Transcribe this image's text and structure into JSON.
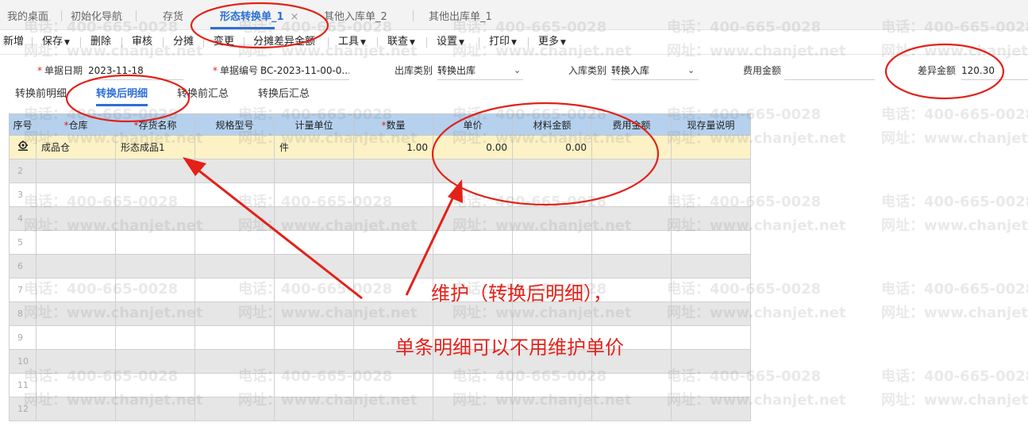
{
  "tabs": [
    {
      "label": "我的桌面"
    },
    {
      "label": "初始化导航"
    },
    {
      "label": "存货"
    },
    {
      "label": "形态转换单_1",
      "close": "×"
    },
    {
      "label": "其他入库单_2"
    },
    {
      "label": "其他出库单_1"
    }
  ],
  "toolbar": {
    "add": "新增",
    "save": "保存",
    "delete": "删除",
    "audit": "审核",
    "allocate": "分摊",
    "change": "变更",
    "allocate_diff": "分摊差异金额",
    "tools": "工具",
    "link_query": "联查",
    "settings": "设置",
    "print": "打印",
    "more": "更多"
  },
  "header": {
    "date_label": "单据日期",
    "date_value": "2023-11-18",
    "doc_no_label": "单据编号",
    "doc_no_value": "BC-2023-11-00-0...",
    "out_type_label": "出库类别",
    "out_type_value": "转换出库",
    "in_type_label": "入库类别",
    "in_type_value": "转换入库",
    "fee_label": "费用金额",
    "fee_value": "",
    "diff_label": "差异金额",
    "diff_value": "120.30"
  },
  "subtabs": [
    "转换前明细",
    "转换后明细",
    "转换前汇总",
    "转换后汇总"
  ],
  "grid": {
    "columns": [
      "序号",
      "仓库",
      "存货名称",
      "规格型号",
      "计量单位",
      "数量",
      "单价",
      "材料金额",
      "费用金额",
      "现存量说明"
    ],
    "rows": [
      {
        "seq": "",
        "warehouse": "成品仓",
        "item": "形态成品1",
        "spec": "",
        "unit": "件",
        "qty": "1.00",
        "price": "0.00",
        "material": "0.00",
        "fee": "",
        "note": ""
      },
      {
        "seq": "2"
      },
      {
        "seq": "3"
      },
      {
        "seq": "4"
      },
      {
        "seq": "5"
      },
      {
        "seq": "6"
      },
      {
        "seq": "7"
      },
      {
        "seq": "8"
      },
      {
        "seq": "9"
      },
      {
        "seq": "10"
      },
      {
        "seq": "11"
      },
      {
        "seq": "12"
      }
    ]
  },
  "watermark": {
    "phone": "电话：400-665-0028",
    "site": "网址：www.chanjet.net"
  },
  "annotation": {
    "line1": "维护（转换后明细），",
    "line2": "单条明细可以不用维护单价",
    "color": "#e32119"
  },
  "colors": {
    "accent": "#2c6fd6",
    "header_row": "#b5d1ee",
    "selected_row": "#fcf2c6",
    "required": "#e02020"
  }
}
